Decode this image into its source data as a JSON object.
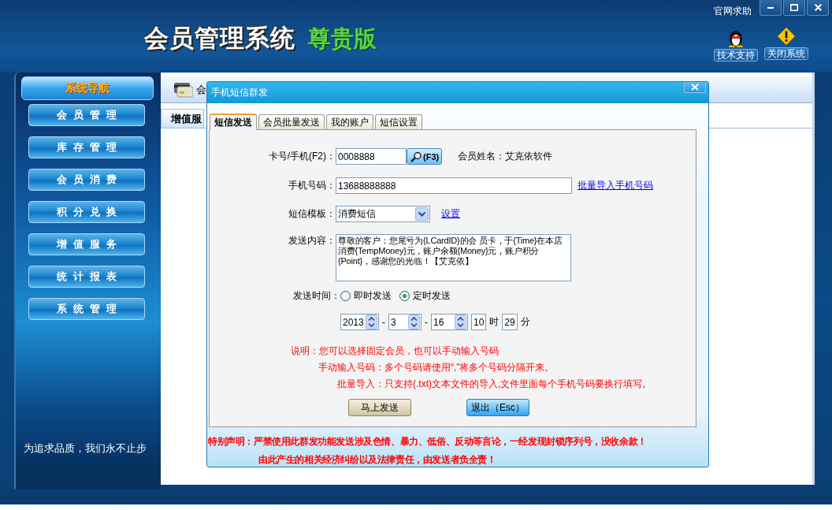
{
  "window": {
    "help_link": "官网求助"
  },
  "header": {
    "title": "会员管理系统",
    "edition": "尊贵版",
    "actions": [
      {
        "kind": "support",
        "label": "技术支持"
      },
      {
        "kind": "exit",
        "label": "关闭系统"
      }
    ]
  },
  "sidebar": {
    "title": "系统导航",
    "items": [
      "会员管理",
      "库存管理",
      "会员消费",
      "积分兑换",
      "增值服务",
      "统计报表",
      "系统管理"
    ],
    "slogan": "为追求品质，我们永不止步"
  },
  "content": {
    "breadcrumb": "会",
    "tab": "增值服"
  },
  "dialog": {
    "title": "手机短信群发",
    "tabs": [
      {
        "label": "短信发送",
        "selected": true
      },
      {
        "label": "会员批量发送",
        "selected": false
      },
      {
        "label": "我的账户",
        "selected": false
      },
      {
        "label": "短信设置",
        "selected": false
      }
    ],
    "form": {
      "card_label": "卡号/手机(F2)：",
      "card_value": "0008888",
      "lookup_button": "(F3)",
      "member_name": "会员姓名：艾克依软件",
      "phone_label": "手机号码：",
      "phone_value": "13688888888",
      "import_link": "批量导入手机号码",
      "template_label": "短信模板：",
      "template_value": "消费短信",
      "settings_link": "设置",
      "content_label": "发送内容：",
      "content_value": "尊敬的客户：您尾号为{LCardID}的会 员卡，于{Time}在本店消费{TempMoney}元，账户余额{Money}元，账户积分{Point}，感谢您的光临！【艾克依】",
      "time_label": "发送时间：",
      "time_options": [
        {
          "label": "即时发送",
          "selected": false
        },
        {
          "label": "定时发送",
          "selected": true
        }
      ],
      "schedule": [
        {
          "kind": "spin",
          "value": "2013"
        },
        {
          "kind": "text",
          "value": "-"
        },
        {
          "kind": "spin",
          "value": "3"
        },
        {
          "kind": "text",
          "value": "-"
        },
        {
          "kind": "spin",
          "value": "16"
        },
        {
          "kind": "box",
          "value": "10"
        },
        {
          "kind": "text",
          "value": "时"
        },
        {
          "kind": "box",
          "value": "29"
        },
        {
          "kind": "text",
          "value": "分"
        }
      ]
    },
    "notes": [
      "说明：您可以选择固定会员，也可以手动输入号码",
      "手动输入号码：多个号码请使用“,”将多个号码分隔开来。",
      "批量导入：只支持(.txt)文本文件的导入,文件里面每个手机号码要换行填写。"
    ],
    "buttons": [
      {
        "kind": "send",
        "label": "马上发送"
      },
      {
        "kind": "exit",
        "label": "退出（Esc）"
      }
    ],
    "notice": [
      "特别声明：严禁使用此群发功能发送涉及色情、暴力、低俗、反动等言论，一经发现封锁序列号，没收余款！",
      "由此产生的相关经济纠纷以及法律责任，由发送者负全责！"
    ]
  }
}
